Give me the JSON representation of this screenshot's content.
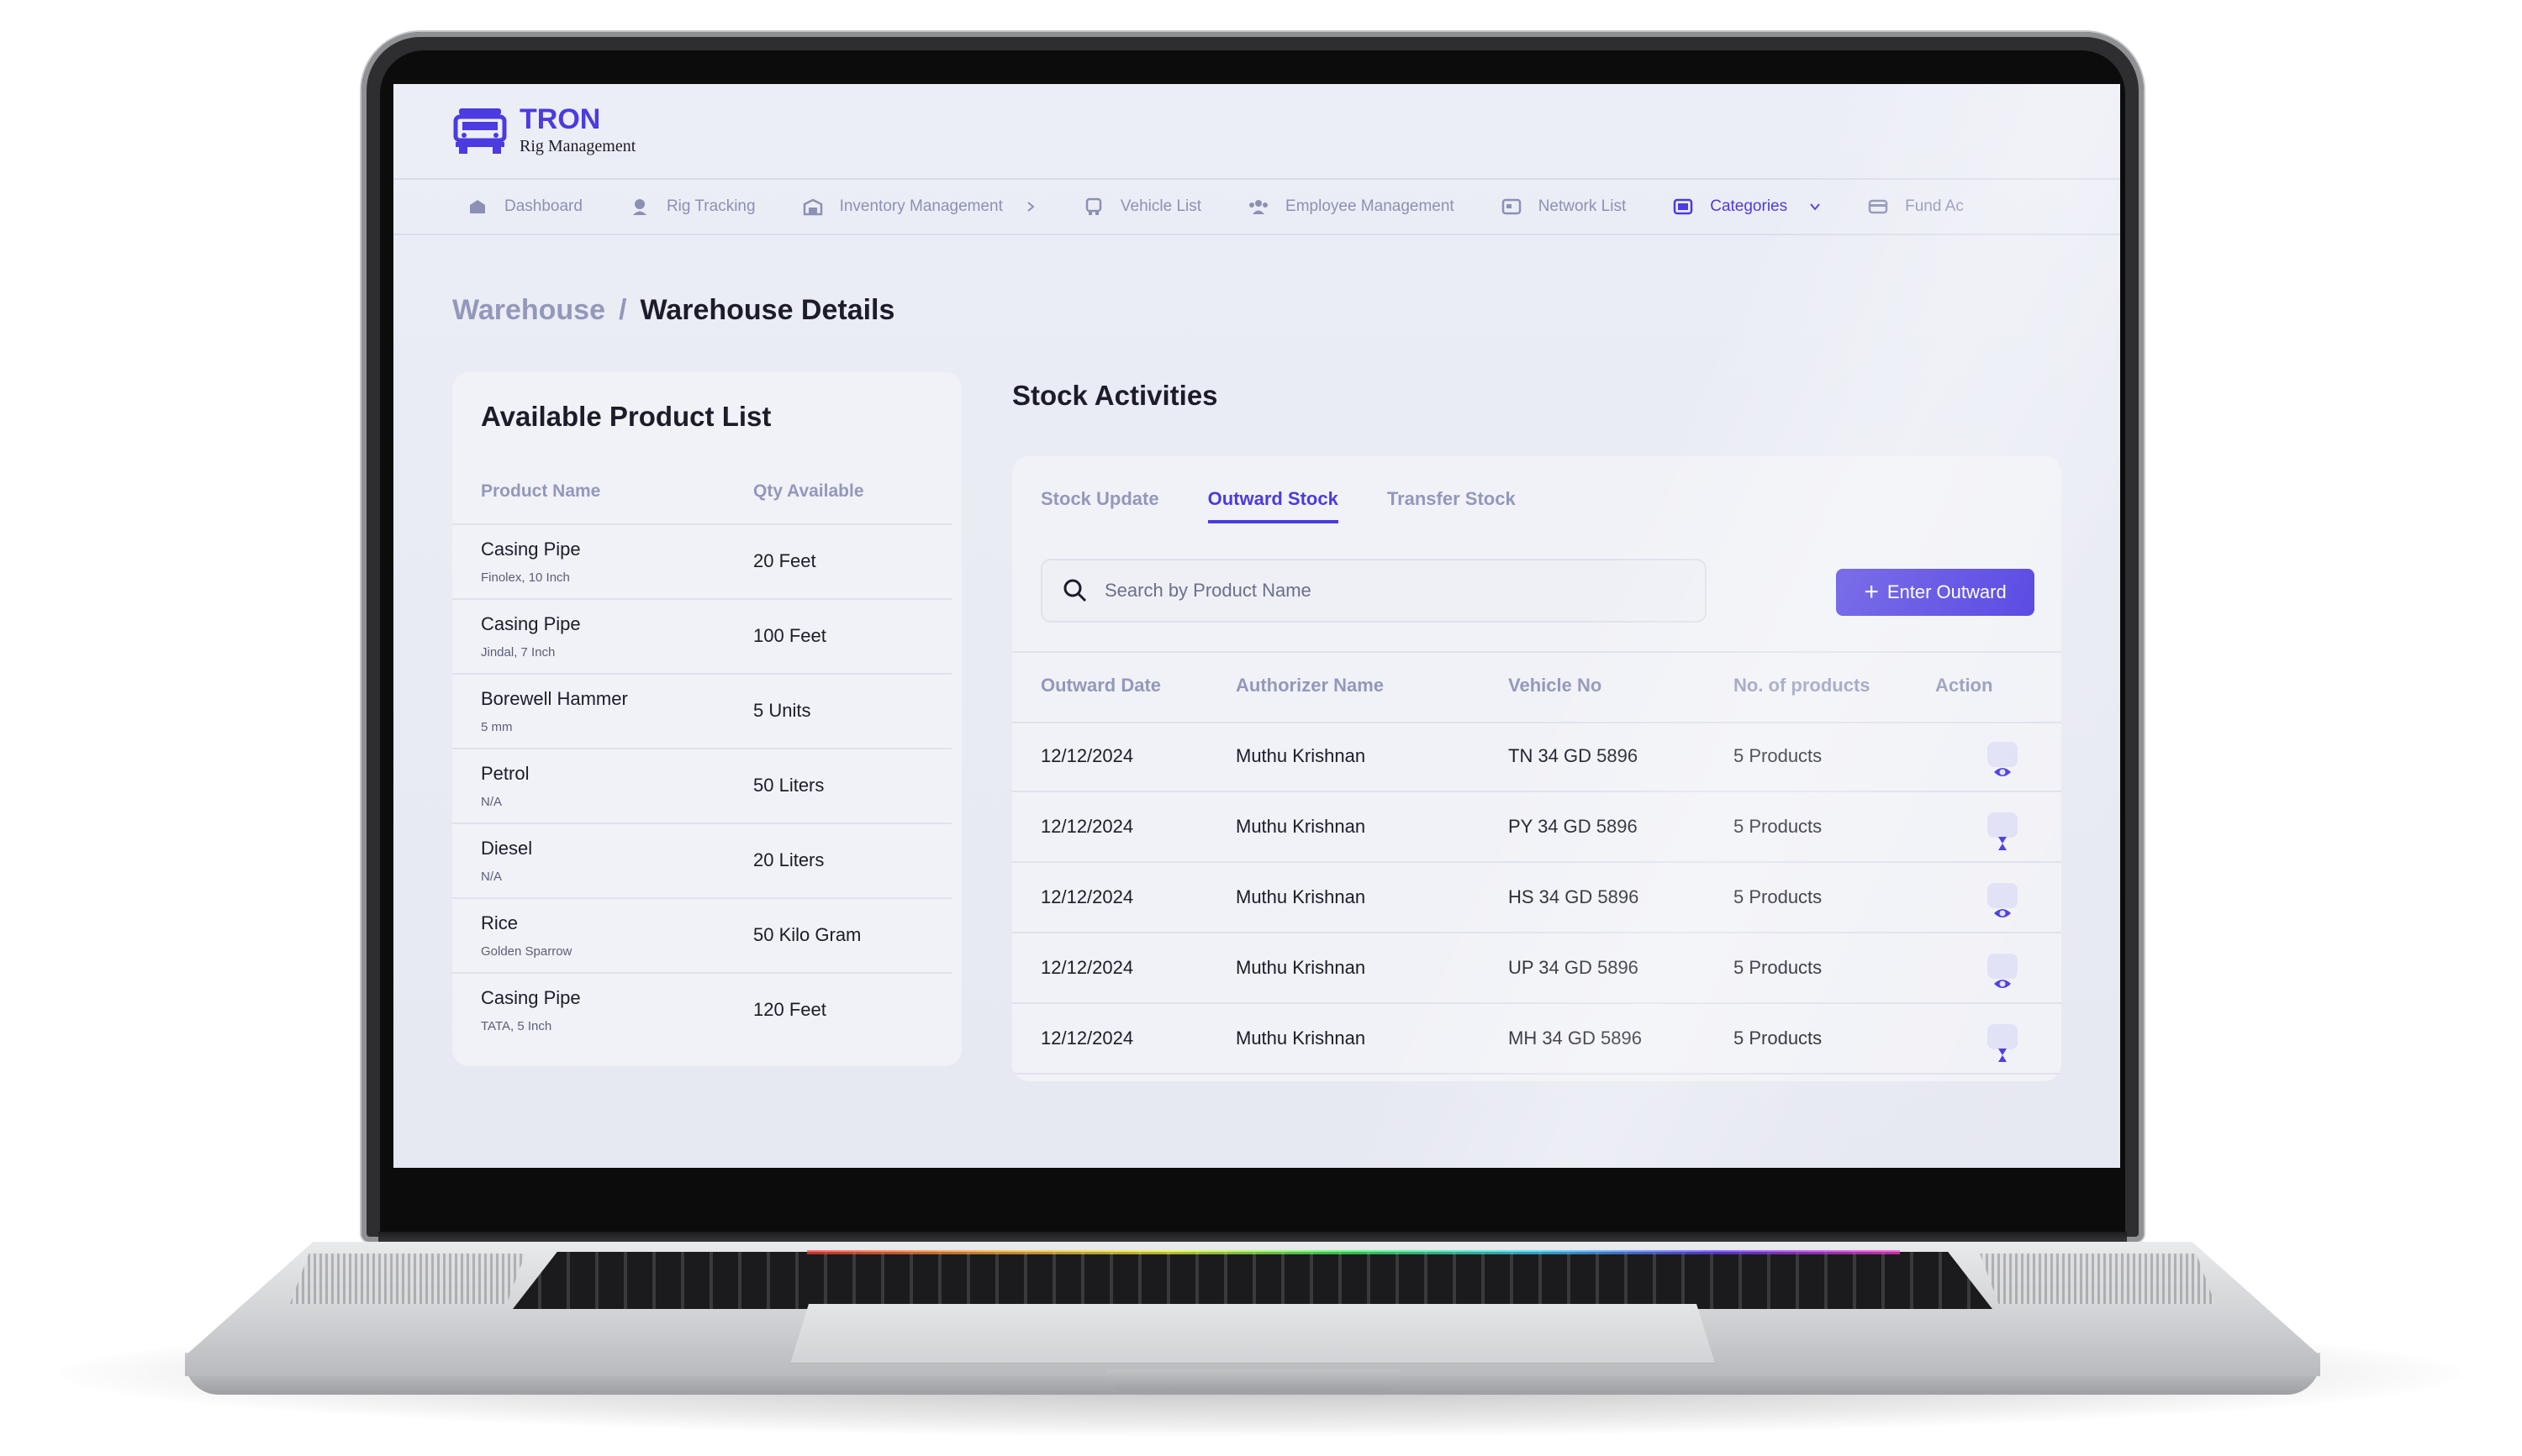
{
  "brand": {
    "name": "TRON",
    "tagline": "Rig Management"
  },
  "nav": [
    {
      "label": "Dashboard",
      "icon": "dashboard-icon"
    },
    {
      "label": "Rig Tracking",
      "icon": "rig-tracking-icon"
    },
    {
      "label": "Inventory Management",
      "icon": "inventory-icon"
    },
    {
      "label": "Vehicle List",
      "icon": "vehicle-icon"
    },
    {
      "label": "Employee Management",
      "icon": "employee-icon"
    },
    {
      "label": "Network List",
      "icon": "network-icon"
    },
    {
      "label": "Categories",
      "icon": "categories-icon",
      "active": true
    },
    {
      "label": "Fund Ac",
      "icon": "fund-icon"
    }
  ],
  "breadcrumb": {
    "parent": "Warehouse",
    "separator": "/",
    "current": "Warehouse Details"
  },
  "product_list": {
    "title": "Available Product List",
    "col_name": "Product Name",
    "col_qty": "Qty Available",
    "rows": [
      {
        "name": "Casing Pipe",
        "desc": "Finolex, 10 Inch",
        "qty": "20 Feet"
      },
      {
        "name": "Casing Pipe",
        "desc": "Jindal, 7 Inch",
        "qty": "100 Feet"
      },
      {
        "name": "Borewell Hammer",
        "desc": "5 mm",
        "qty": "5 Units"
      },
      {
        "name": "Petrol",
        "desc": "N/A",
        "qty": "50 Liters"
      },
      {
        "name": "Diesel",
        "desc": "N/A",
        "qty": "20 Liters"
      },
      {
        "name": "Rice",
        "desc": "Golden Sparrow",
        "qty": "50 Kilo Gram"
      },
      {
        "name": "Casing Pipe",
        "desc": "TATA, 5 Inch",
        "qty": "120 Feet"
      }
    ]
  },
  "stock": {
    "title": "Stock Activities",
    "tabs": [
      "Stock Update",
      "Outward Stock",
      "Transfer Stock"
    ],
    "active_tab": "Outward Stock",
    "search_placeholder": "Search by Product Name",
    "button_label": "Enter Outward",
    "columns": [
      "Outward Date",
      "Authorizer Name",
      "Vehicle No",
      "No. of products",
      "Action"
    ],
    "rows": [
      {
        "date": "12/12/2024",
        "authorizer": "Muthu Krishnan",
        "vehicle": "TN 34 GD 5896",
        "products": "5 Products",
        "action_icon": "eye-icon"
      },
      {
        "date": "12/12/2024",
        "authorizer": "Muthu Krishnan",
        "vehicle": "PY 34 GD 5896",
        "products": "5 Products",
        "action_icon": "hourglass-icon"
      },
      {
        "date": "12/12/2024",
        "authorizer": "Muthu Krishnan",
        "vehicle": "HS 34 GD 5896",
        "products": "5 Products",
        "action_icon": "eye-icon"
      },
      {
        "date": "12/12/2024",
        "authorizer": "Muthu Krishnan",
        "vehicle": "UP 34 GD 5896",
        "products": "5 Products",
        "action_icon": "eye-icon"
      },
      {
        "date": "12/12/2024",
        "authorizer": "Muthu Krishnan",
        "vehicle": "MH 34 GD 5896",
        "products": "5 Products",
        "action_icon": "hourglass-icon"
      }
    ]
  },
  "colors": {
    "accent": "#4b3be0",
    "muted": "#9398bb",
    "text": "#1c1c2a",
    "card": "#f1f2f7"
  }
}
